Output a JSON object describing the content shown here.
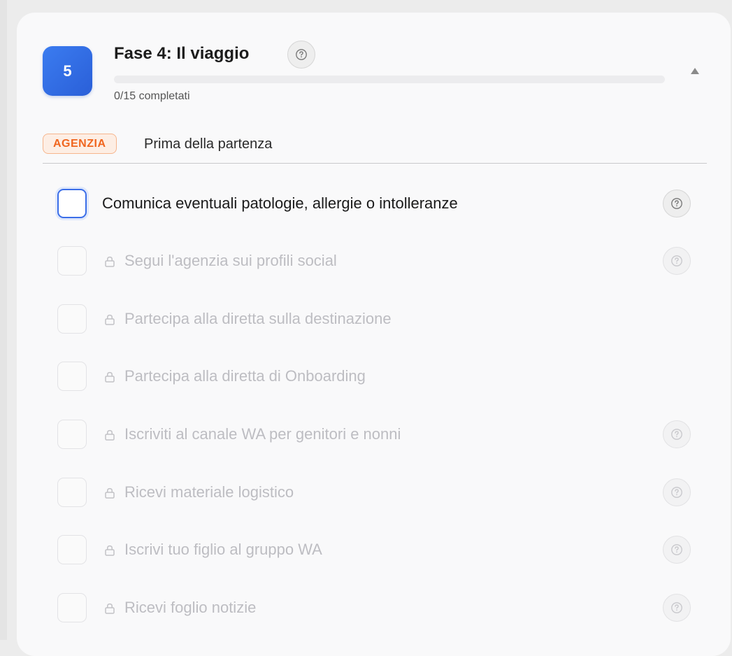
{
  "phase": {
    "number": "5",
    "title": "Fase 4: Il viaggio",
    "help_icon": "question-circle-icon",
    "progress_text": "0/15 completati",
    "progress_fraction": 0,
    "collapse_icon": "caret-up-icon"
  },
  "section": {
    "badge": "AGENZIA",
    "title": "Prima della partenza"
  },
  "tasks": [
    {
      "label": "Comunica eventuali patologie, allergie o intolleranze",
      "locked": false,
      "help": true
    },
    {
      "label": "Segui l'agenzia sui profili social",
      "locked": true,
      "help": true
    },
    {
      "label": "Partecipa alla diretta sulla destinazione",
      "locked": true,
      "help": false
    },
    {
      "label": "Partecipa alla diretta di Onboarding",
      "locked": true,
      "help": false
    },
    {
      "label": "Iscriviti al canale WA per genitori e nonni",
      "locked": true,
      "help": true
    },
    {
      "label": "Ricevi materiale logistico",
      "locked": true,
      "help": true
    },
    {
      "label": "Iscrivi tuo figlio al gruppo WA",
      "locked": true,
      "help": true
    },
    {
      "label": "Ricevi foglio notizie",
      "locked": true,
      "help": true
    }
  ],
  "colors": {
    "accent": "#3b7cf0",
    "badge_orange": "#f0661f",
    "locked_text": "#bdbdc2"
  }
}
